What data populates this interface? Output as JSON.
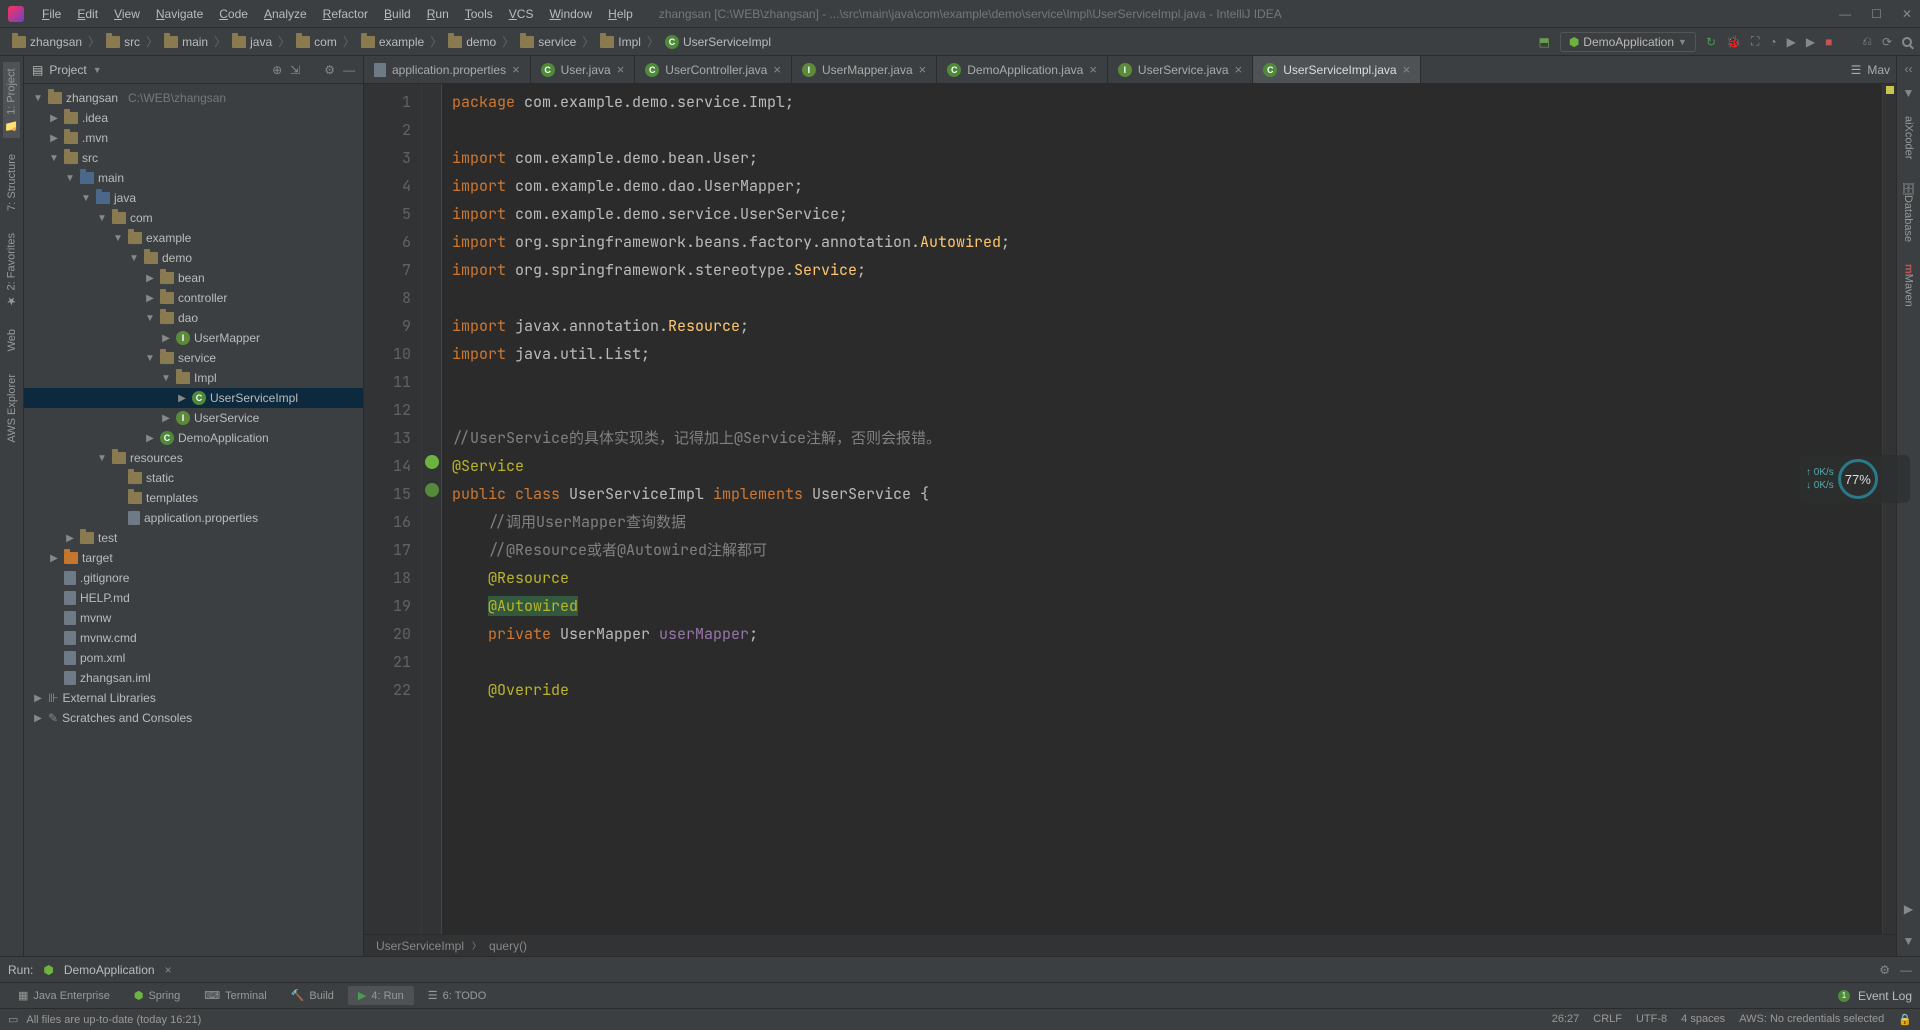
{
  "title": "zhangsan [C:\\WEB\\zhangsan] - ...\\src\\main\\java\\com\\example\\demo\\service\\Impl\\UserServiceImpl.java - IntelliJ IDEA",
  "menu": [
    "File",
    "Edit",
    "View",
    "Navigate",
    "Code",
    "Analyze",
    "Refactor",
    "Build",
    "Run",
    "Tools",
    "VCS",
    "Window",
    "Help"
  ],
  "breadcrumbs": [
    "zhangsan",
    "src",
    "main",
    "java",
    "com",
    "example",
    "demo",
    "service",
    "Impl",
    "UserServiceImpl"
  ],
  "runConfig": "DemoApplication",
  "project": {
    "title": "Project",
    "root": {
      "name": "zhangsan",
      "path": "C:\\WEB\\zhangsan"
    },
    "nodes": [
      {
        "indent": 0,
        "arrow": "▼",
        "icon": "folder",
        "label": "zhangsan",
        "path": "C:\\WEB\\zhangsan"
      },
      {
        "indent": 1,
        "arrow": "▶",
        "icon": "folder",
        "label": ".idea"
      },
      {
        "indent": 1,
        "arrow": "▶",
        "icon": "folder",
        "label": ".mvn"
      },
      {
        "indent": 1,
        "arrow": "▼",
        "icon": "folder",
        "label": "src"
      },
      {
        "indent": 2,
        "arrow": "▼",
        "icon": "folder-blue",
        "label": "main"
      },
      {
        "indent": 3,
        "arrow": "▼",
        "icon": "folder-blue",
        "label": "java"
      },
      {
        "indent": 4,
        "arrow": "▼",
        "icon": "folder",
        "label": "com"
      },
      {
        "indent": 5,
        "arrow": "▼",
        "icon": "folder",
        "label": "example"
      },
      {
        "indent": 6,
        "arrow": "▼",
        "icon": "folder",
        "label": "demo"
      },
      {
        "indent": 7,
        "arrow": "▶",
        "icon": "folder",
        "label": "bean"
      },
      {
        "indent": 7,
        "arrow": "▶",
        "icon": "folder",
        "label": "controller"
      },
      {
        "indent": 7,
        "arrow": "▼",
        "icon": "folder",
        "label": "dao"
      },
      {
        "indent": 8,
        "arrow": "▶",
        "icon": "interface",
        "label": "UserMapper"
      },
      {
        "indent": 7,
        "arrow": "▼",
        "icon": "folder",
        "label": "service"
      },
      {
        "indent": 8,
        "arrow": "▼",
        "icon": "folder",
        "label": "Impl"
      },
      {
        "indent": 9,
        "arrow": "▶",
        "icon": "class",
        "label": "UserServiceImpl",
        "selected": true
      },
      {
        "indent": 8,
        "arrow": "▶",
        "icon": "interface",
        "label": "UserService"
      },
      {
        "indent": 7,
        "arrow": "▶",
        "icon": "class",
        "label": "DemoApplication"
      },
      {
        "indent": 4,
        "arrow": "▼",
        "icon": "folder",
        "label": "resources"
      },
      {
        "indent": 5,
        "arrow": "",
        "icon": "folder",
        "label": "static"
      },
      {
        "indent": 5,
        "arrow": "",
        "icon": "folder",
        "label": "templates"
      },
      {
        "indent": 5,
        "arrow": "",
        "icon": "file",
        "label": "application.properties"
      },
      {
        "indent": 2,
        "arrow": "▶",
        "icon": "folder",
        "label": "test"
      },
      {
        "indent": 1,
        "arrow": "▶",
        "icon": "folder-orange",
        "label": "target"
      },
      {
        "indent": 1,
        "arrow": "",
        "icon": "file",
        "label": ".gitignore"
      },
      {
        "indent": 1,
        "arrow": "",
        "icon": "file",
        "label": "HELP.md"
      },
      {
        "indent": 1,
        "arrow": "",
        "icon": "file",
        "label": "mvnw"
      },
      {
        "indent": 1,
        "arrow": "",
        "icon": "file",
        "label": "mvnw.cmd"
      },
      {
        "indent": 1,
        "arrow": "",
        "icon": "file",
        "label": "pom.xml"
      },
      {
        "indent": 1,
        "arrow": "",
        "icon": "file",
        "label": "zhangsan.iml"
      },
      {
        "indent": 0,
        "arrow": "▶",
        "icon": "lib",
        "label": "External Libraries"
      },
      {
        "indent": 0,
        "arrow": "▶",
        "icon": "scratch",
        "label": "Scratches and Consoles"
      }
    ]
  },
  "editorTabs": [
    {
      "icon": "file",
      "label": "application.properties"
    },
    {
      "icon": "class",
      "label": "User.java"
    },
    {
      "icon": "class",
      "label": "UserController.java"
    },
    {
      "icon": "interface",
      "label": "UserMapper.java"
    },
    {
      "icon": "class",
      "label": "DemoApplication.java"
    },
    {
      "icon": "interface",
      "label": "UserService.java"
    },
    {
      "icon": "class",
      "label": "UserServiceImpl.java",
      "active": true
    }
  ],
  "moreTabLabel": "Mav",
  "code": {
    "lines": [
      {
        "n": 1,
        "html": "<span class='kw'>package</span> com.example.demo.service.Impl;"
      },
      {
        "n": 2,
        "html": ""
      },
      {
        "n": 3,
        "html": "<span class='kw'>import</span> com.example.demo.bean.User;"
      },
      {
        "n": 4,
        "html": "<span class='kw'>import</span> com.example.demo.dao.UserMapper;"
      },
      {
        "n": 5,
        "html": "<span class='kw'>import</span> com.example.demo.service.UserService;"
      },
      {
        "n": 6,
        "html": "<span class='kw'>import</span> org.springframework.beans.factory.annotation.<span class='id'>Autowired</span>;"
      },
      {
        "n": 7,
        "html": "<span class='kw'>import</span> org.springframework.stereotype.<span class='id'>Service</span>;"
      },
      {
        "n": 8,
        "html": ""
      },
      {
        "n": 9,
        "html": "<span class='kw'>import</span> javax.annotation.<span class='id'>Resource</span>;"
      },
      {
        "n": 10,
        "html": "<span class='kw'>import</span> java.util.List;"
      },
      {
        "n": 11,
        "html": ""
      },
      {
        "n": 12,
        "html": ""
      },
      {
        "n": 13,
        "html": "<span class='cmt'>//UserService的具体实现类，记得加上@Service注解，否则会报错。</span>"
      },
      {
        "n": 14,
        "html": "<span class='ann'>@Service</span>",
        "icon": "spring"
      },
      {
        "n": 15,
        "html": "<span class='kw'>public class</span> UserServiceImpl <span class='kw'>implements</span> UserService {",
        "icon": "impl"
      },
      {
        "n": 16,
        "html": "    <span class='cmt'>//调用UserMapper查询数据</span>"
      },
      {
        "n": 17,
        "html": "    <span class='cmt'>//@Resource或者@Autowired注解都可</span>"
      },
      {
        "n": 18,
        "html": "    <span class='ann'>@Resource</span>"
      },
      {
        "n": 19,
        "html": "    <span class='ann highlight'>@Autowired</span>"
      },
      {
        "n": 20,
        "html": "    <span class='kw'>private</span> UserMapper <span class='purple'>userMapper</span>;"
      },
      {
        "n": 21,
        "html": ""
      },
      {
        "n": 22,
        "html": "    <span class='ann'>@Override</span>"
      }
    ]
  },
  "editorBreadcrumb": [
    "UserServiceImpl",
    "query()"
  ],
  "leftSideTabs": [
    "1: Project",
    "7: Structure",
    "2: Favorites",
    "Web",
    "AWS Explorer"
  ],
  "rightSideTabs": [
    "aiXcoder",
    "Database",
    "Maven"
  ],
  "runPanel": {
    "label": "Run:",
    "config": "DemoApplication"
  },
  "bottomTabs": [
    {
      "label": "Java Enterprise"
    },
    {
      "label": "Spring"
    },
    {
      "label": "Terminal"
    },
    {
      "label": "Build"
    },
    {
      "label": "4: Run",
      "active": true
    },
    {
      "label": "6: TODO"
    }
  ],
  "eventLog": "Event Log",
  "status": {
    "msg": "All files are up-to-date (today 16:21)",
    "pos": "26:27",
    "le": "CRLF",
    "enc": "UTF-8",
    "indent": "4 spaces",
    "aws": "AWS: No credentials selected",
    "lock": "🔒"
  },
  "cpu": {
    "percent": "77%",
    "up": "0K/s",
    "down": "0K/s"
  }
}
